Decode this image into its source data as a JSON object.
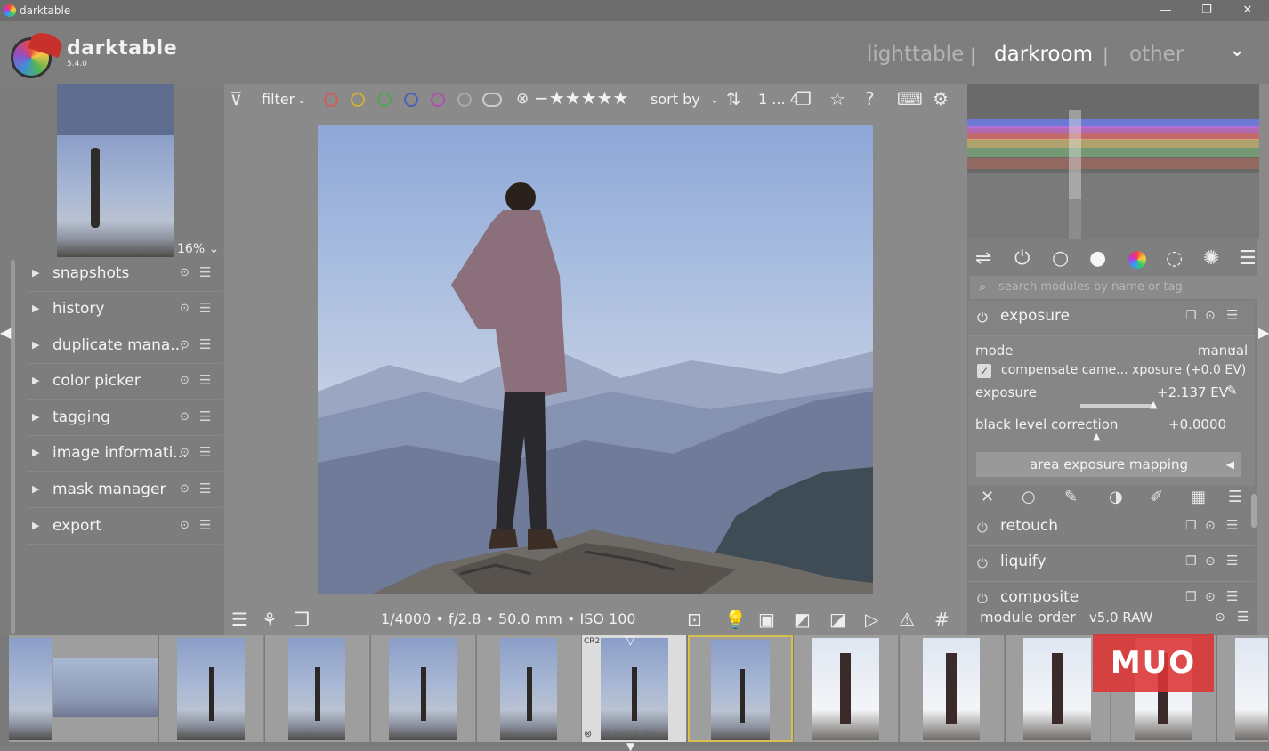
{
  "window": {
    "title": "darktable",
    "minimize": "—",
    "maximize": "❐",
    "close": "✕"
  },
  "app": {
    "name": "darktable",
    "version": "5.4.0"
  },
  "views": {
    "lighttable": "lighttable",
    "darkroom": "darkroom",
    "other": "other",
    "sep": "|",
    "menu": "⌄"
  },
  "navigator": {
    "zoom": "16% ⌄"
  },
  "left_modules": [
    {
      "label": "snapshots"
    },
    {
      "label": "history"
    },
    {
      "label": "duplicate mana..."
    },
    {
      "label": "color picker"
    },
    {
      "label": "tagging"
    },
    {
      "label": "image informati..."
    },
    {
      "label": "mask manager"
    },
    {
      "label": "export"
    }
  ],
  "top_toolbar": {
    "filter": "filter",
    "sort_by": "sort by",
    "count": "1 ... 4",
    "color_labels": [
      "#d35a5a",
      "#c8b23a",
      "#4fa54f",
      "#4e5fb8",
      "#b04fb0"
    ]
  },
  "info_bar": {
    "text": "1/4000 • f/2.8 • 50.0 mm • ISO 100"
  },
  "right_panel": {
    "search_placeholder": "search modules by name or tag",
    "exposure": {
      "title": "exposure",
      "mode_label": "mode",
      "mode_value": "manual",
      "compensate": "compensate came... xposure (+0.0 EV)",
      "compensate_checked": true,
      "exposure_label": "exposure",
      "exposure_value": "+2.137 EV",
      "exposure_level": 0.45,
      "black_label": "black level correction",
      "black_value": "+0.0000",
      "area_button": "area exposure mapping"
    },
    "retouch": "retouch",
    "liquify": "liquify",
    "composite": "composite",
    "module_order_label": "module order",
    "module_order_value": "v5.0 RAW"
  },
  "filmstrip": {
    "format_badge": "CR2",
    "watermark": "MUO"
  }
}
